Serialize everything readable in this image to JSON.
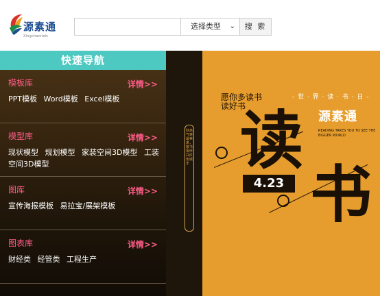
{
  "header": {
    "logo_text": "源素通",
    "logo_sub": "Xingchannels",
    "search_value": "",
    "select_value": "选择类型",
    "search_button": "搜 索"
  },
  "sidebar": {
    "title": "快速导航",
    "sections": [
      {
        "title": "模板库",
        "more": "详情>>",
        "links": [
          "PPT模板",
          "Word模板",
          "Excel模板"
        ]
      },
      {
        "title": "模型库",
        "more": "详情>>",
        "links": [
          "现状模型",
          "规划模型",
          "家装空间3D模型",
          "工装空间3D模型"
        ]
      },
      {
        "title": "图库",
        "more": "详情>>",
        "links": [
          "宣传海报模板",
          "易拉宝/展架模板"
        ]
      },
      {
        "title": "图表库",
        "more": "详情>>",
        "links": [
          "财经类",
          "经管类",
          "工程生产"
        ]
      }
    ]
  },
  "banner": {
    "vertical_text": "秋高气爽最美来，敬书相伴共红色城乐",
    "wish_line1": "愿你多读书",
    "wish_line2": "读好书",
    "day_text": "- 世 · 界 · 读 · 书 · 日 -",
    "brand": "源素通",
    "english": "READING TAKES YOU TO SEE THE BIGGER WORLD",
    "char1": "读",
    "char2": "书",
    "date": "4.23"
  },
  "colors": {
    "accent_teal": "#4ec9c1",
    "pink": "#ff5c88",
    "banner_orange": "#e79d2d"
  }
}
